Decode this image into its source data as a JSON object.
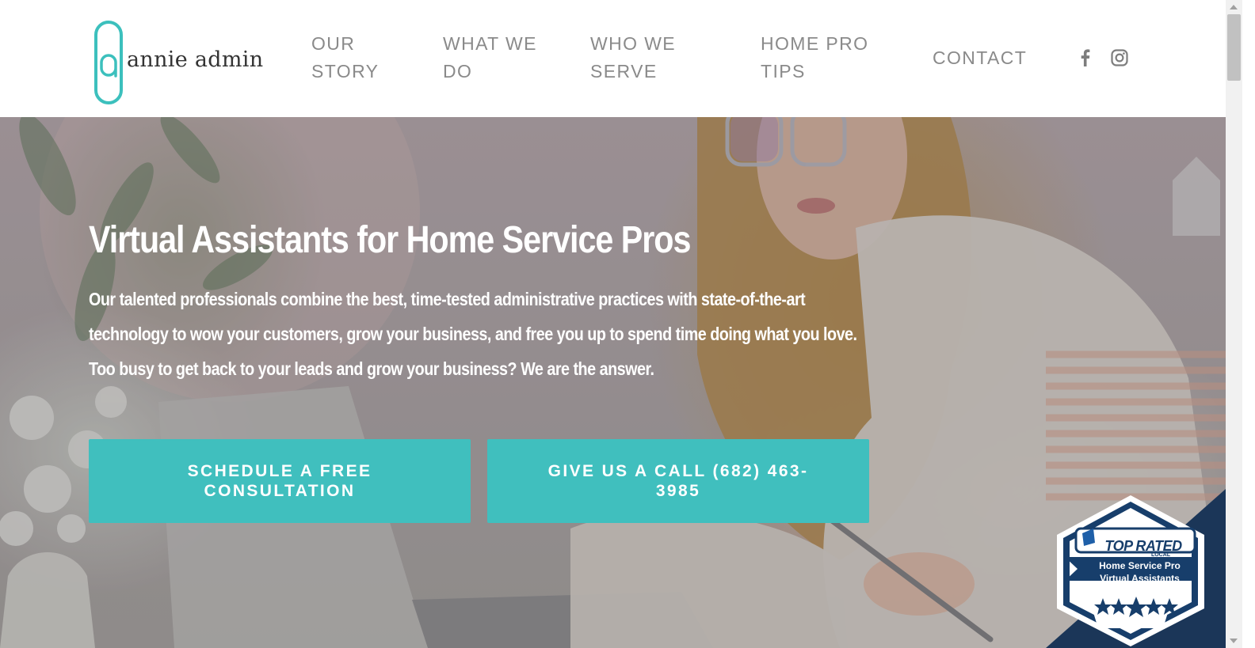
{
  "logo": {
    "text": "annie admin"
  },
  "nav": [
    {
      "label": "OUR\nSTORY"
    },
    {
      "label": "WHAT WE\nDO"
    },
    {
      "label": "WHO WE\nSERVE"
    },
    {
      "label": "HOME PRO\nTIPS"
    },
    {
      "label": "CONTACT"
    }
  ],
  "social": {
    "facebook_icon": "facebook-icon",
    "instagram_icon": "instagram-icon"
  },
  "hero": {
    "title": "Virtual Assistants for Home Service Pros",
    "text": "Our talented professionals combine the best, time-tested administrative practices with state-of-the-art technology to wow your customers, grow your business, and free you up to spend time doing what you love. Too busy to get back to your leads and grow your business? We are the answer.",
    "cta_primary": "SCHEDULE A FREE CONSULTATION",
    "cta_secondary": "GIVE US A CALL (682) 463-3985"
  },
  "badge": {
    "brand": "TOP RATED",
    "sub": "LOCAL",
    "line1": "Home Service Pro",
    "line2": "Virtual Assistants"
  },
  "colors": {
    "accent": "#40bfbe",
    "nav_text": "#8a8a8a",
    "badge_navy": "#163a66"
  }
}
